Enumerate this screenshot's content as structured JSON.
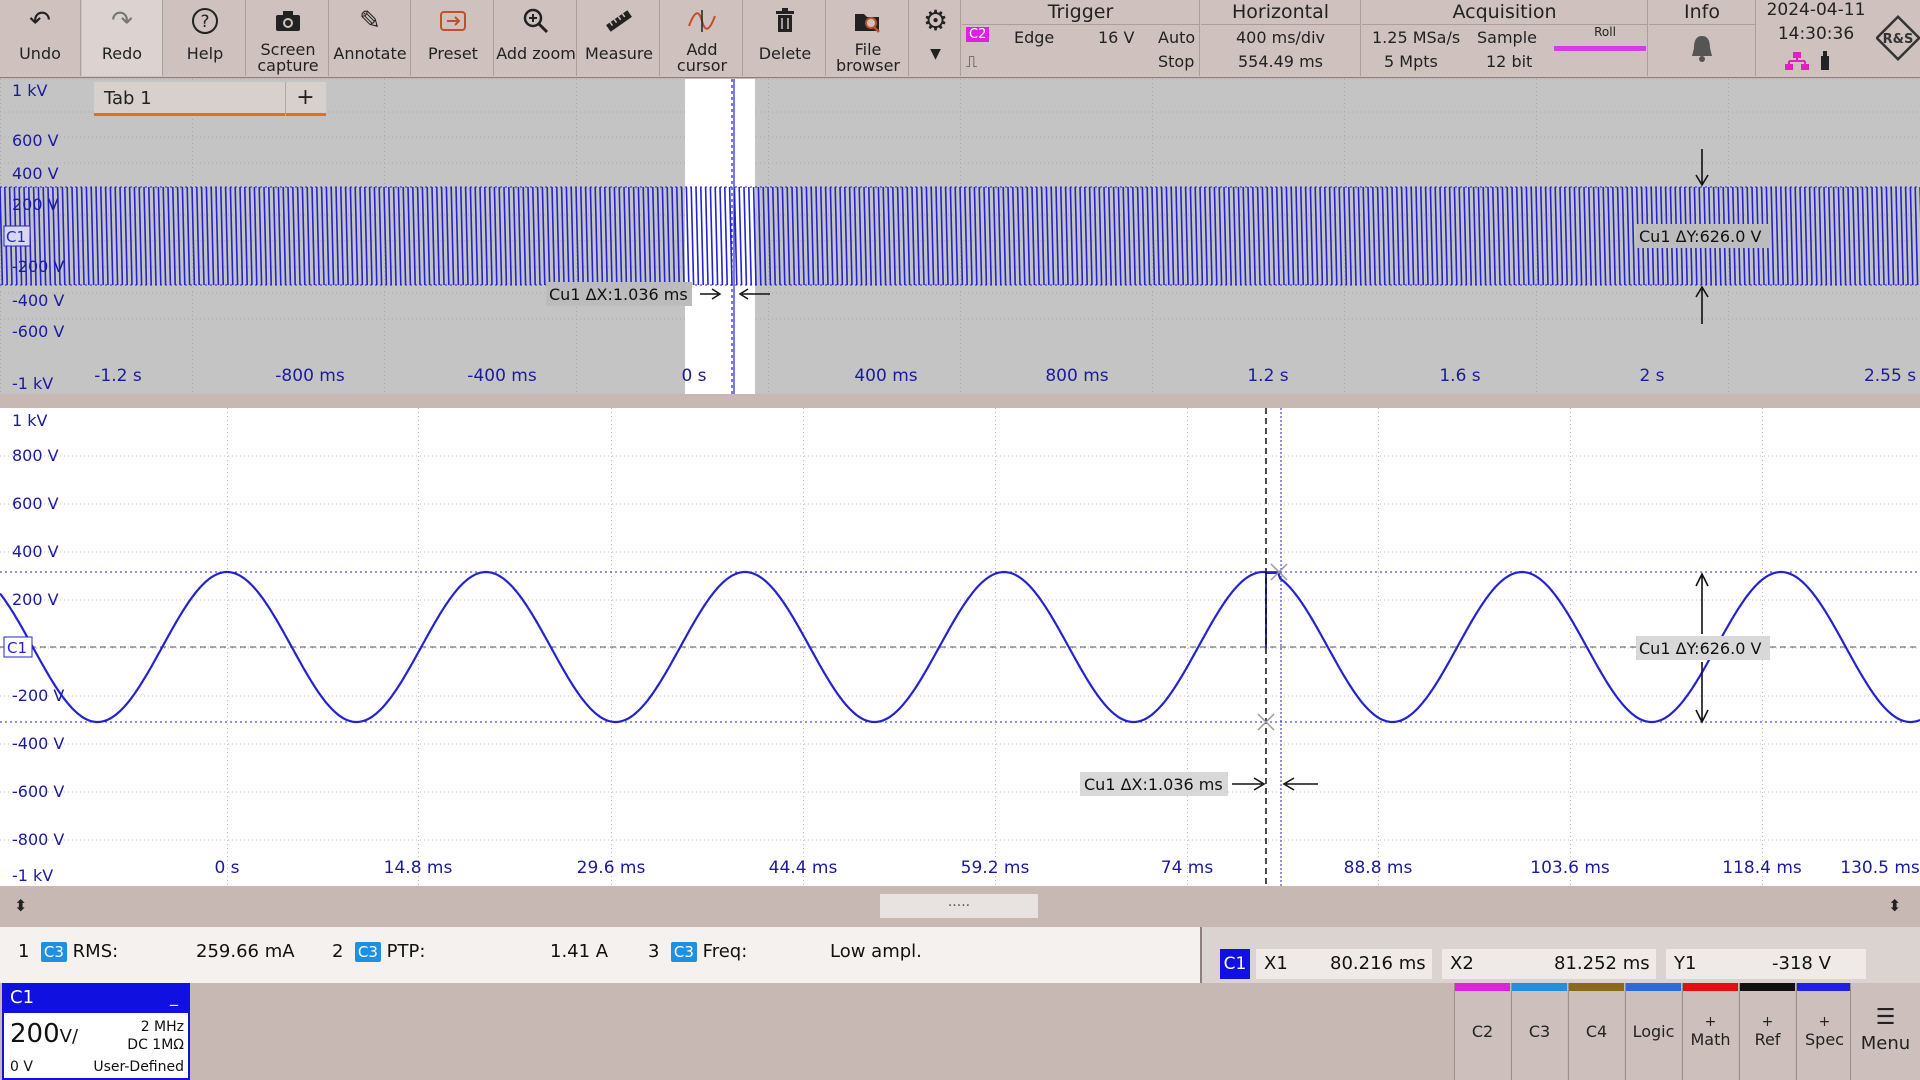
{
  "toolbar": {
    "undo": "Undo",
    "redo": "Redo",
    "help": "Help",
    "screen_capture_1": "Screen",
    "screen_capture_2": "capture",
    "annotate": "Annotate",
    "preset": "Preset",
    "add_zoom": "Add zoom",
    "measure": "Measure",
    "add_cursor_1": "Add",
    "add_cursor_2": "cursor",
    "delete": "Delete",
    "file_browser_1": "File",
    "file_browser_2": "browser"
  },
  "trigger": {
    "title": "Trigger",
    "source": "C2",
    "type": "Edge",
    "level": "16 V",
    "mode": "Auto",
    "state": "Stop"
  },
  "horizontal": {
    "title": "Horizontal",
    "scale": "400 ms/div",
    "position": "554.49 ms"
  },
  "acquisition": {
    "title": "Acquisition",
    "rate": "1.25 MSa/s",
    "mode": "Sample",
    "points": "5 Mpts",
    "bits": "12 bit",
    "roll": "Roll"
  },
  "info": {
    "title": "Info"
  },
  "datetime": {
    "date": "2024-04-11",
    "time": "14:30:36"
  },
  "overview": {
    "tab": "Tab 1",
    "add_tab": "+",
    "y_labels": [
      "1 kV",
      "600 V",
      "400 V",
      "200 V",
      "-200 V",
      "-400 V",
      "-600 V",
      "-1 kV"
    ],
    "x_labels": [
      "-1.2 s",
      "-800 ms",
      "-400 ms",
      "0 s",
      "400 ms",
      "800 ms",
      "1.2 s",
      "1.6 s",
      "2 s",
      "2.55 s"
    ],
    "channel_marker": "C1",
    "dx_label": "Cu1 ΔX:1.036 ms",
    "dy_label": "Cu1 ΔY:626.0 V"
  },
  "zoom": {
    "y_labels": [
      "1 kV",
      "800 V",
      "600 V",
      "400 V",
      "200 V",
      "-200 V",
      "-400 V",
      "-600 V",
      "-800 V",
      "-1 kV"
    ],
    "x_labels": [
      "0 s",
      "14.8 ms",
      "29.6 ms",
      "44.4 ms",
      "59.2 ms",
      "74 ms",
      "88.8 ms",
      "103.6 ms",
      "118.4 ms",
      "130.5 ms"
    ],
    "channel_marker": "C1",
    "dx_label": "Cu1 ΔX:1.036 ms",
    "dy_label": "Cu1 ΔY:626.0 V"
  },
  "splitter": {
    "handle": "....."
  },
  "measurements": [
    {
      "index": "1",
      "source": "C3",
      "name": "RMS:",
      "value": "259.66 mA"
    },
    {
      "index": "2",
      "source": "C3",
      "name": "PTP:",
      "value": "1.41 A"
    },
    {
      "index": "3",
      "source": "C3",
      "name": "Freq:",
      "value": "Low ampl."
    }
  ],
  "cursor_readout": {
    "channel": "C1",
    "x1_label": "X1",
    "x1": "80.216  ms",
    "x2_label": "X2",
    "x2": "81.252  ms",
    "y1_label": "Y1",
    "y1": "-318  V"
  },
  "channel_box": {
    "name": "C1",
    "minimize": "_",
    "scale": "200",
    "unit": "V/",
    "bandwidth": "2 MHz",
    "coupling": "DC 1MΩ",
    "offset": "0 V",
    "probe": "User-Defined"
  },
  "bottom_buttons": [
    {
      "label": "C2",
      "color": "#e020e0"
    },
    {
      "label": "C3",
      "color": "#1f8fe0"
    },
    {
      "label": "C4",
      "color": "#8a6a1a"
    },
    {
      "label": "Logic",
      "color": "#2a6adf"
    },
    {
      "label": "Math",
      "color": "#e01010"
    },
    {
      "label": "Ref",
      "color": "#111111"
    },
    {
      "label": "Spec",
      "color": "#2020e0"
    }
  ],
  "menu": "Menu",
  "colors": {
    "waveform": "#2323d0",
    "overview_bg": "#c4c4c4",
    "zoom_bg": "#ffffff"
  }
}
